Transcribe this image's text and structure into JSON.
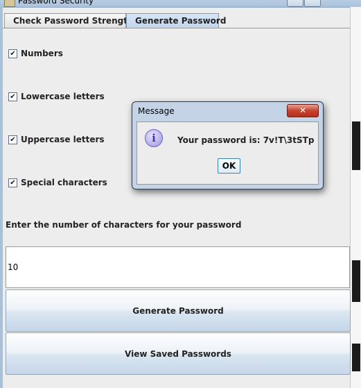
{
  "window": {
    "title": "Password Security"
  },
  "tabs": [
    {
      "label": "Check Password Strength",
      "active": false
    },
    {
      "label": "Generate Password",
      "active": true
    }
  ],
  "options": [
    {
      "label": "Numbers",
      "checked": true
    },
    {
      "label": "Lowercase letters",
      "checked": true
    },
    {
      "label": "Uppercase letters",
      "checked": true
    },
    {
      "label": "Special characters",
      "checked": true
    }
  ],
  "length_prompt": "Enter the number of characters for your password",
  "length_value": "10",
  "buttons": {
    "generate": "Generate Password",
    "view_saved": "View Saved Passwords"
  },
  "dialog": {
    "title": "Message",
    "close_label": "✕",
    "message": "Your password is: 7v!T\\3tSTp",
    "ok": "OK"
  },
  "check_glyph": "✔",
  "colors": {
    "dialog_frame": "#c4d4e6",
    "close_button": "#c7432e",
    "button_face": "#d9e5f1"
  }
}
